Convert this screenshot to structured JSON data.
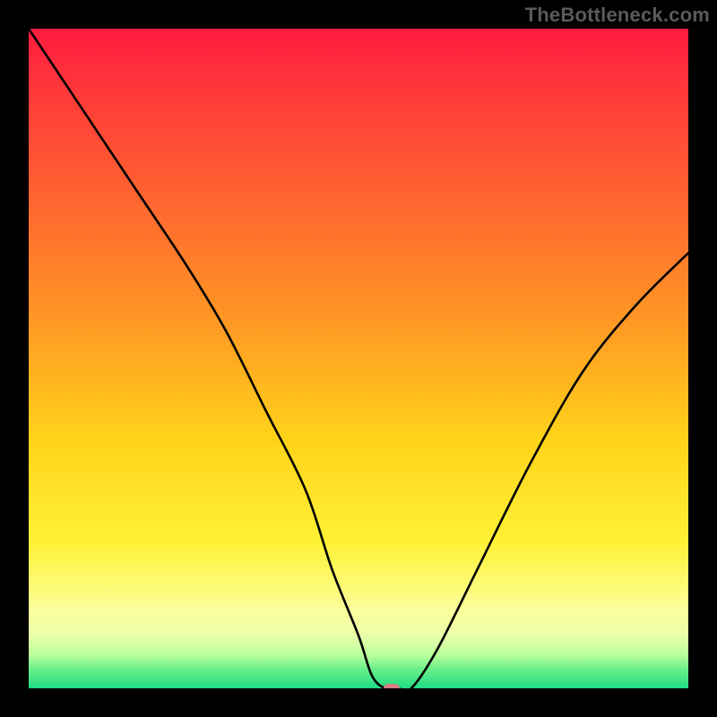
{
  "watermark": "TheBottleneck.com",
  "chart_data": {
    "type": "line",
    "title": "",
    "xlabel": "",
    "ylabel": "",
    "xlim": [
      0,
      100
    ],
    "ylim": [
      0,
      100
    ],
    "x": [
      0,
      8,
      16,
      24,
      30,
      36,
      42,
      46,
      50,
      52,
      54,
      56,
      58,
      62,
      68,
      76,
      84,
      92,
      100
    ],
    "y": [
      100,
      88,
      76,
      64,
      54,
      42,
      30,
      18,
      8,
      2,
      0,
      0,
      0,
      6,
      18,
      34,
      48,
      58,
      66
    ],
    "marker": {
      "x": 55,
      "y": 0,
      "color": "#d68084"
    },
    "gradient_stops": [
      {
        "pos": 0,
        "color": "#ff1b3f"
      },
      {
        "pos": 10,
        "color": "#ff3a3a"
      },
      {
        "pos": 28,
        "color": "#ff6a2f"
      },
      {
        "pos": 45,
        "color": "#ff9a24"
      },
      {
        "pos": 62,
        "color": "#ffd21a"
      },
      {
        "pos": 78,
        "color": "#fff236"
      },
      {
        "pos": 88,
        "color": "#fbff9a"
      },
      {
        "pos": 92,
        "color": "#e9ffa9"
      },
      {
        "pos": 95,
        "color": "#b8ff9c"
      },
      {
        "pos": 97,
        "color": "#6cf08a"
      },
      {
        "pos": 100,
        "color": "#1fdc84"
      }
    ]
  }
}
